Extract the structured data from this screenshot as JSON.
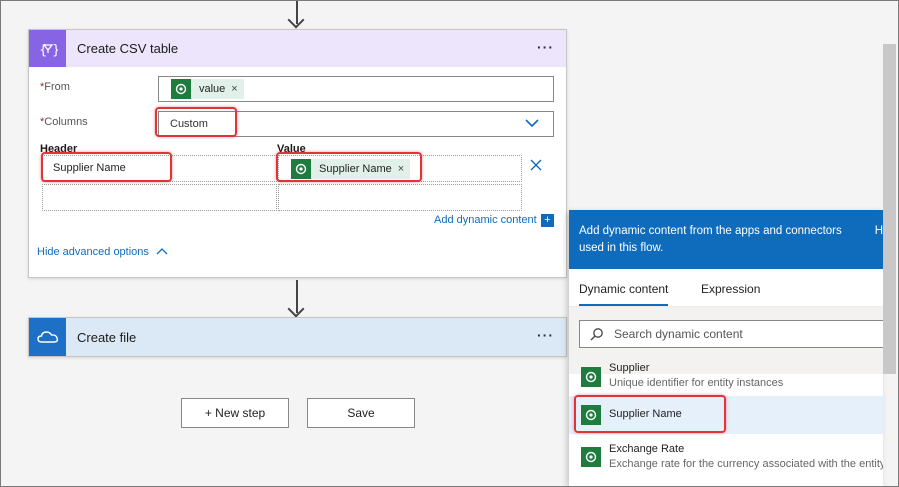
{
  "csv_card": {
    "title": "Create CSV table",
    "menu": "···",
    "from_label": "From",
    "from_token": "value",
    "columns_label": "Columns",
    "columns_value": "Custom",
    "header_label": "Header",
    "value_label": "Value",
    "header_cell": "Supplier Name",
    "value_token": "Supplier Name",
    "required_marker": "*",
    "add_dynamic": "Add dynamic content",
    "hide_advanced": "Hide advanced options"
  },
  "file_card": {
    "title": "Create file",
    "menu": "···"
  },
  "buttons": {
    "new_step": "+ New step",
    "save": "Save"
  },
  "dynamic_panel": {
    "header_text": "Add dynamic content from the apps and connectors used in this flow.",
    "hide_partial": "H",
    "tabs": [
      "Dynamic content",
      "Expression"
    ],
    "search_placeholder": "Search dynamic content",
    "items": [
      {
        "title": "Supplier",
        "subtitle": "Unique identifier for entity instances"
      },
      {
        "title": "Supplier Name",
        "subtitle": ""
      },
      {
        "title": "Exchange Rate",
        "subtitle": "Exchange rate for the currency associated with the entity"
      }
    ]
  },
  "colors": {
    "csv_header": "#ece5fb",
    "csv_icon": "#8764e3",
    "file_header": "#dbe9f6",
    "file_icon": "#1e6fc6",
    "dataverse": "#1e7c3e",
    "highlight": "#e0343a",
    "accent": "#0f6cbd"
  }
}
